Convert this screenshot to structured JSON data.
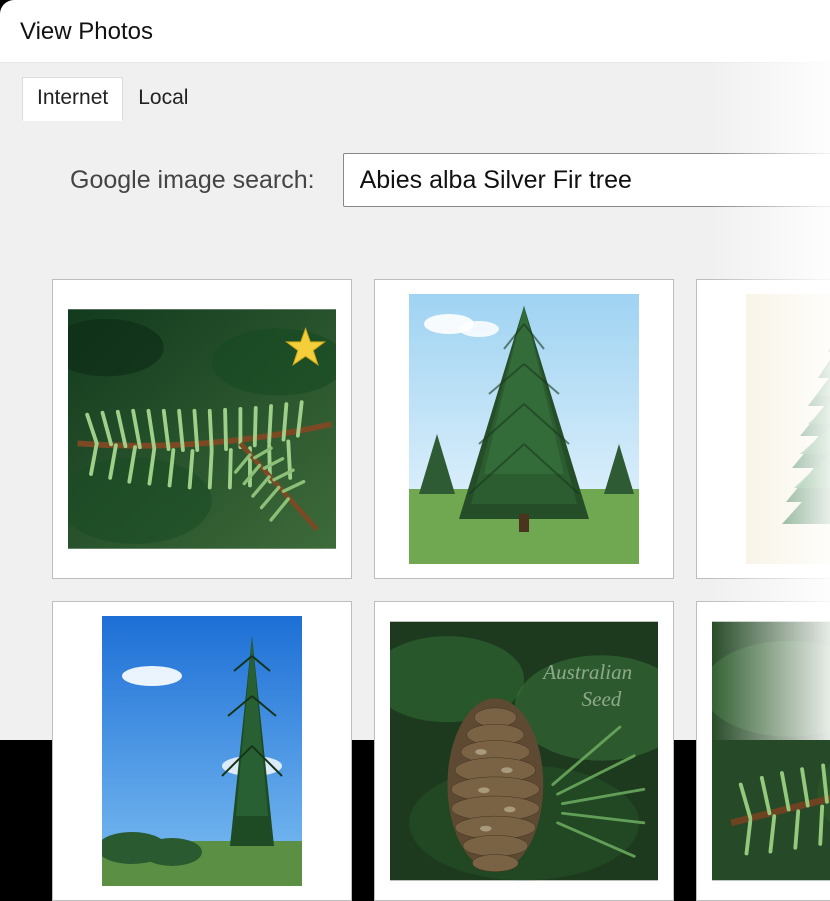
{
  "window": {
    "title": "View Photos"
  },
  "tabs": {
    "internet": "Internet",
    "local": "Local",
    "active": "internet"
  },
  "search": {
    "label": "Google image search:",
    "value": "Abies alba Silver Fir tree",
    "placeholder": ""
  },
  "results": [
    {
      "name": "result-1-fir-needles-closeup"
    },
    {
      "name": "result-2-fir-tree-lawn"
    },
    {
      "name": "result-3-fir-tree-illustration"
    },
    {
      "name": "result-4-fir-tree-sky"
    },
    {
      "name": "result-5-fir-cone-australian-seed"
    },
    {
      "name": "result-6-fir-needles-closeup-2"
    }
  ]
}
